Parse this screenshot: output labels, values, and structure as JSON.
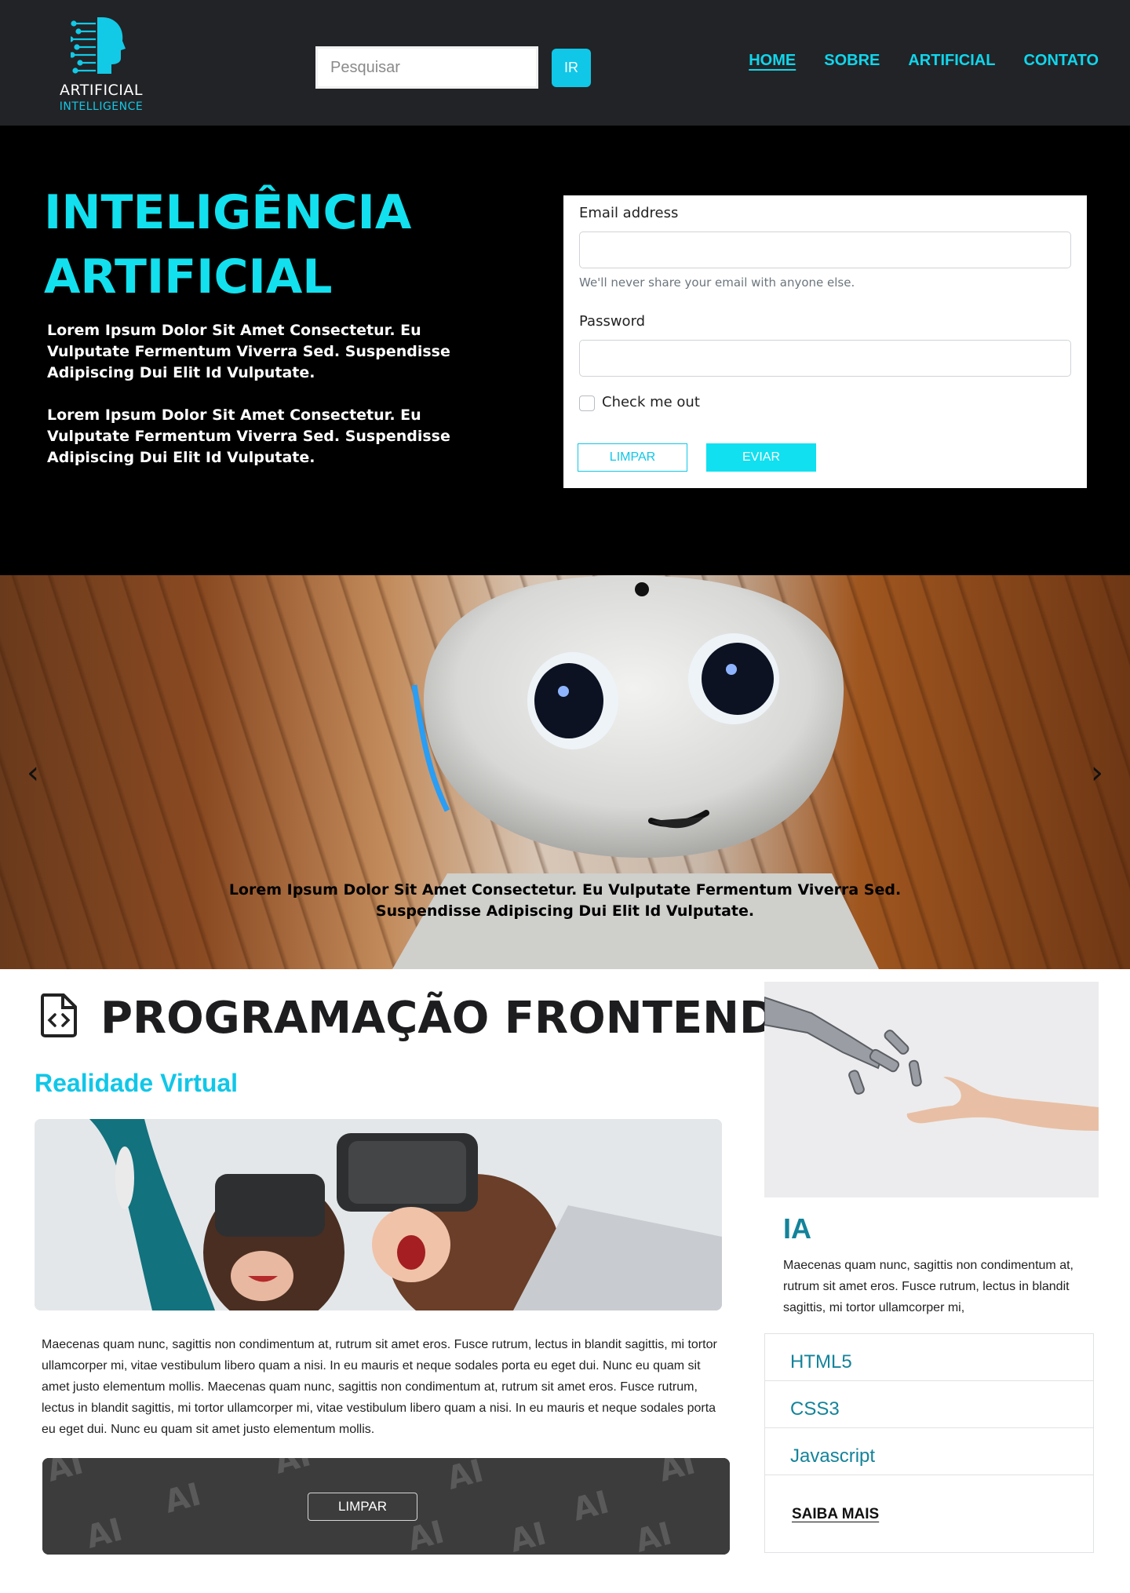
{
  "brand": {
    "logo_line1": "ARTIFICIAL",
    "logo_line2": "INTELLIGENCE",
    "accent": "#10c7e8"
  },
  "search": {
    "placeholder": "Pesquisar",
    "button": "IR"
  },
  "nav": {
    "items": [
      {
        "label": "HOME",
        "active": true
      },
      {
        "label": "SOBRE",
        "active": false
      },
      {
        "label": "ARTIFICIAL",
        "active": false
      },
      {
        "label": "CONTATO",
        "active": false
      }
    ]
  },
  "hero": {
    "title": "INTELIGÊNCIA ARTIFICIAL",
    "paragraphs": [
      "Lorem Ipsum Dolor Sit Amet Consectetur. Eu Vulputate Fermentum Viverra Sed. Suspendisse Adipiscing Dui Elit Id Vulputate.",
      "Lorem Ipsum Dolor Sit Amet Consectetur. Eu Vulputate Fermentum Viverra Sed. Suspendisse Adipiscing Dui Elit Id Vulputate."
    ]
  },
  "form": {
    "email_label": "Email address",
    "email_value": "",
    "email_help": "We'll never share your email with anyone else.",
    "password_label": "Password",
    "password_value": "",
    "check_label": "Check me out",
    "checked": false,
    "clear_button": "LIMPAR",
    "submit_button": "EVIAR"
  },
  "carousel": {
    "caption": "Lorem Ipsum Dolor Sit Amet Consectetur. Eu Vulputate Fermentum Viverra Sed. Suspendisse Adipiscing Dui Elit Id Vulputate.",
    "prev_icon": "chevron-left-icon",
    "next_icon": "chevron-right-icon"
  },
  "main": {
    "section_icon": "file-code-icon",
    "section_title": "PROGRAMAÇÃO FRONTEND",
    "subtitle": "Realidade Virtual",
    "paragraph": "Maecenas quam nunc, sagittis non condimentum at, rutrum sit amet eros. Fusce rutrum, lectus in blandit sagittis, mi tortor ullamcorper mi, vitae vestibulum libero quam a nisi. In eu mauris et neque sodales porta eu eget dui. Nunc eu quam sit amet justo elementum mollis. Maecenas quam nunc, sagittis non condimentum at, rutrum sit amet eros. Fusce rutrum, lectus in blandit sagittis, mi tortor ullamcorper mi, vitae vestibulum libero quam a nisi. In eu mauris et neque sodales porta eu eget dui. Nunc eu quam sit amet justo elementum mollis.",
    "banner_button": "LIMPAR"
  },
  "card": {
    "title": "IA",
    "text": "Maecenas quam nunc, sagittis non condimentum at, rutrum sit amet eros. Fusce rutrum, lectus in blandit sagittis, mi tortor ullamcorper mi,",
    "list": [
      "HTML5",
      "CSS3",
      "Javascript"
    ],
    "link": "SAIBA MAIS"
  }
}
